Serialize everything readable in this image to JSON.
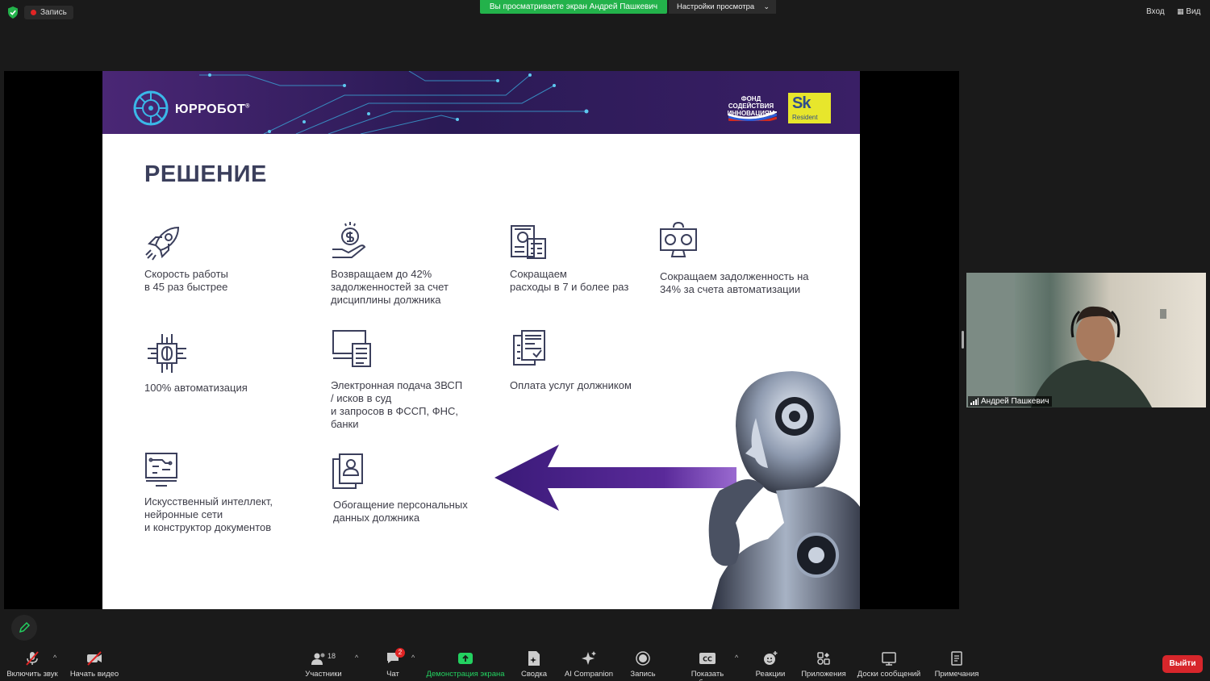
{
  "top_bar": {
    "recording_label": "Запись",
    "share_banner": "Вы просматриваете экран Андрей Пашкевич",
    "view_settings": "Настройки просмотра",
    "sign_in": "Вход",
    "view": "Вид"
  },
  "slide": {
    "brand": "ЮРРОБОТ",
    "brand_mark": "®",
    "fund_text": "ФОНД СОДЕЙСТВИЯ ИННОВАЦИЯМ",
    "sk_logo": "Sk",
    "sk_resident": "Resident",
    "title": "РЕШЕНИЕ",
    "features": [
      {
        "text": "Скорость работы\nв 45 раз быстрее",
        "icon": "rocket-icon"
      },
      {
        "text": "Возвращаем до 42%\nзадолженностей за счет\nдисциплины должника",
        "icon": "money-hand-icon"
      },
      {
        "text": "Сокращаем\nрасходы в 7 и более раз",
        "icon": "calculator-icon"
      },
      {
        "text": "Сокращаем задолженность на\n34% за счета автоматизации",
        "icon": "monitor-money-icon"
      },
      {
        "text": "100% автоматизация",
        "icon": "chip-brain-icon"
      },
      {
        "text": "Электронная подача ЗВСП\n/ исков в суд\nи запросов в ФССП, ФНС,\nбанки",
        "icon": "laptop-document-icon"
      },
      {
        "text": "Оплата услуг должником",
        "icon": "invoice-icon"
      },
      {
        "text": "Искусственный интеллект,\nнейронные сети\nи конструктор документов",
        "icon": "computer-circuit-icon"
      },
      {
        "text": "Обогащение персональных\nданных должника",
        "icon": "profile-document-icon"
      }
    ]
  },
  "webcam": {
    "participant_name": "Андрей Пашкевич"
  },
  "toolbar": {
    "unmute": "Включить звук",
    "start_video": "Начать видео",
    "participants": "Участники",
    "participants_count": "18",
    "chat": "Чат",
    "chat_badge": "2",
    "share_screen": "Демонстрация экрана",
    "summary": "Сводка",
    "ai_companion": "AI Companion",
    "record": "Запись",
    "captions": "Показать субтитры",
    "reactions": "Реакции",
    "apps": "Приложения",
    "whiteboards": "Доски сообщений",
    "notes": "Примечания",
    "leave": "Выйти"
  },
  "colors": {
    "share_green": "#23b24b",
    "leave_red": "#d7262b",
    "slide_purple": "#4a2775",
    "arrow_purple": "#4b1f86"
  }
}
